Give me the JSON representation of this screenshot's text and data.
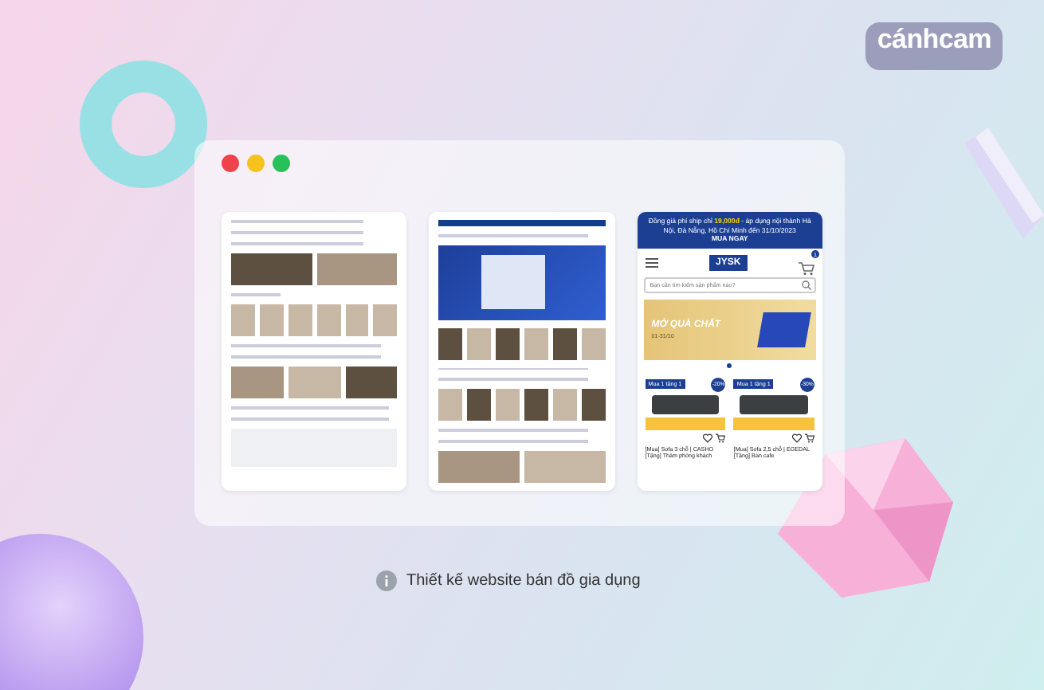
{
  "brand": {
    "logo": "cánhcam"
  },
  "window": {
    "controls": [
      {
        "color": "#f0424a"
      },
      {
        "color": "#f6c21c"
      },
      {
        "color": "#27c15a"
      }
    ]
  },
  "screens": [
    {
      "kind": "desktop-catalog"
    },
    {
      "kind": "desktop-home"
    },
    {
      "kind": "mobile",
      "promo_bar": {
        "text": "Đồng giá phí ship chỉ **19,000đ** - áp dụng nội thành Hà Nội, Đà Nẵng, Hồ Chí Minh đến 31/10/2023",
        "cta": "MUA NGAY"
      },
      "logo": "JYSK",
      "cart_count": "1",
      "search": {
        "placeholder": "Bạn cần tìm kiếm sản phẩm nào?"
      },
      "banner": {
        "title": "MỞ QUÀ CHẤT",
        "dates": "01-31/10"
      },
      "products": [
        {
          "tag": "Mua 1 tặng 1",
          "discount": "-20%",
          "name": "[Mua] Sofa 3 chỗ | CASHO [Tặng] Thảm phòng khách"
        },
        {
          "tag": "Mua 1 tặng 1",
          "discount": "-30%",
          "name": "[Mua] Sofa 2,5 chỗ | EGEDAL [Tặng] Bàn cafe"
        }
      ]
    }
  ],
  "caption": {
    "text": "Thiết kế website bán đồ gia dụng"
  }
}
